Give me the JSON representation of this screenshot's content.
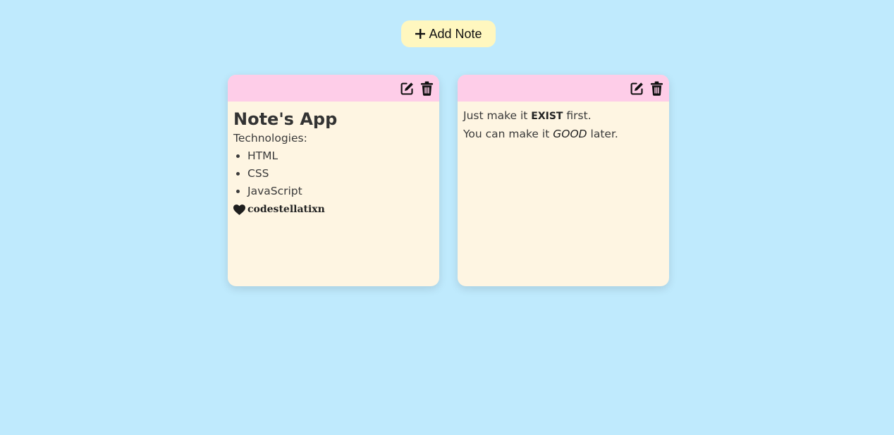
{
  "toolbar": {
    "add_note_label": "Add Note",
    "add_icon": "plus-icon"
  },
  "notes": [
    {
      "title": "Note's App",
      "intro": "Technologies:",
      "items": [
        "HTML",
        "CSS",
        "JavaScript"
      ],
      "signature": "codestellatixn",
      "signature_icon": "heart-icon",
      "tools": [
        "edit-icon",
        "trash-icon"
      ]
    },
    {
      "line1_before": "Just make it",
      "line1_bold": "EXIST",
      "line1_after": "first.",
      "line2_before": "You can make it",
      "line2_italic": "GOOD",
      "line2_after": "later.",
      "tools": [
        "edit-icon",
        "trash-icon"
      ]
    }
  ],
  "colors": {
    "background": "#bfeafd",
    "button_bg": "#fff7bf",
    "note_bar": "#fecde8",
    "note_body": "#fef5e2"
  }
}
